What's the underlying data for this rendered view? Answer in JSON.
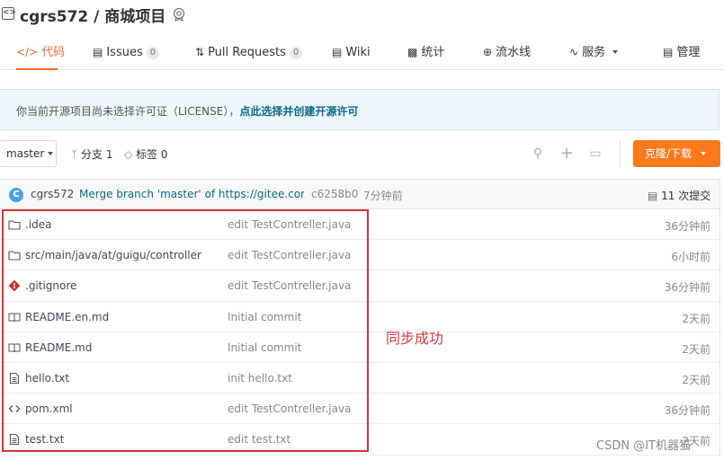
{
  "repo": {
    "title": "cgrs572 / 商城项目"
  },
  "tabs": [
    {
      "label": "代码",
      "icon": "code-icon"
    },
    {
      "label": "Issues",
      "count": "0",
      "icon": "issues-icon"
    },
    {
      "label": "Pull Requests",
      "count": "0",
      "icon": "pull-request-icon"
    },
    {
      "label": "Wiki",
      "icon": "wiki-icon"
    },
    {
      "label": "统计",
      "icon": "stats-icon"
    },
    {
      "label": "流水线",
      "icon": "pipeline-icon"
    },
    {
      "label": "服务",
      "icon": "service-icon"
    },
    {
      "label": "管理",
      "icon": "manage-icon"
    }
  ],
  "notice": {
    "text": "你当前开源项目尚未选择许可证（LICENSE），",
    "link": "点此选择并创建开源许可"
  },
  "toolbar": {
    "branch": "master",
    "branches": "分支 1",
    "tags": "标签 0",
    "clone_label": "克隆/下载"
  },
  "commit": {
    "author": "cgrs572",
    "avatar_letter": "C",
    "message": "Merge branch 'master' of https://gitee.com...",
    "hash": "c6258b0",
    "time": "7分钟前",
    "total": "11 次提交"
  },
  "files": [
    {
      "name": ".idea",
      "type": "folder",
      "message": "edit TestContreller.java",
      "time": "36分钟前"
    },
    {
      "name": "src/main/java/at/guigu/controller",
      "type": "folder",
      "message": "edit TestContreller.java",
      "time": "6小时前"
    },
    {
      "name": ".gitignore",
      "type": "git",
      "message": "edit TestContreller.java",
      "time": "36分钟前"
    },
    {
      "name": "README.en.md",
      "type": "readme",
      "message": "Initial commit",
      "time": "2天前"
    },
    {
      "name": "README.md",
      "type": "readme",
      "message": "Initial commit",
      "time": "2天前"
    },
    {
      "name": "hello.txt",
      "type": "file",
      "message": "init hello.txt",
      "time": "2天前"
    },
    {
      "name": "pom.xml",
      "type": "code",
      "message": "edit TestContreller.java",
      "time": "36分钟前"
    },
    {
      "name": "test.txt",
      "type": "file",
      "message": "edit test.txt",
      "time": "2天前"
    }
  ],
  "annotation": "同步成功",
  "watermark": "CSDN @IT机器猫",
  "colors": {
    "accent": "#f26b2e",
    "clone_button": "#fa7a1c",
    "annotation": "#d9353b",
    "notice_link": "#0a6b8a"
  }
}
